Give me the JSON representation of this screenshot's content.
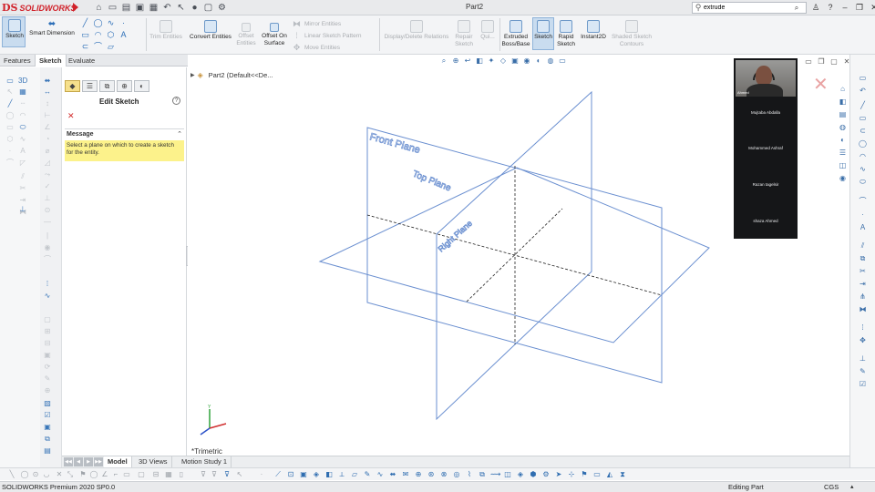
{
  "app": {
    "brand": "SOLIDWORKS",
    "document_title": "Part2",
    "search_value": "extrude"
  },
  "command_manager": {
    "sketch": "Sketch",
    "smart_dimension": "Smart Dimension",
    "trim_entities": "Trim Entities",
    "convert_entities": "Convert Entities",
    "offset_entities": "Offset Entities",
    "offset_on_surface": "Offset On Surface",
    "mirror_entities": "Mirror Entities",
    "linear_sketch_pattern": "Linear Sketch Pattern",
    "move_entities": "Move Entities",
    "display_delete_relations": "Display/Delete Relations",
    "repair_sketch": "Repair Sketch",
    "quick_snaps": "Qui...",
    "extruded_boss_base": "Extruded Boss/Base",
    "sketch_active": "Sketch",
    "rapid_sketch": "Rapid Sketch",
    "instant2d": "Instant2D",
    "shaded_sketch_contours": "Shaded Sketch Contours"
  },
  "tabs": [
    "Features",
    "Sketch",
    "Evaluate"
  ],
  "property_manager": {
    "title": "Edit Sketch",
    "message_header": "Message",
    "message_text": "Select a plane on which to create a sketch for the entity."
  },
  "tree": {
    "label": "Part2  (Default<<De..."
  },
  "planes": {
    "front": "Front Plane",
    "top": "Top Plane",
    "right": "Right Plane"
  },
  "view_orientation": "*Trimetric",
  "call": {
    "self_label": "Ahmed",
    "participants": [
      "Mujtaba Abdalla",
      "Mohammed Ashraf",
      "Razan tagelsir",
      "shaza Ahmed"
    ]
  },
  "bottom_tabs": [
    "Model",
    "3D Views",
    "Motion Study 1"
  ],
  "status": {
    "left": "SOLIDWORKS Premium 2020 SP0.0",
    "mode": "Editing Part",
    "units": "CGS"
  }
}
